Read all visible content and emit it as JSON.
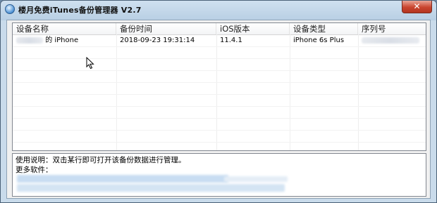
{
  "window": {
    "title": "楼月免费iTunes备份管理器 V2.7",
    "close_glyph": "✕"
  },
  "backup_list": {
    "columns": [
      {
        "label": "设备名称"
      },
      {
        "label": "备份时间"
      },
      {
        "label": "iOS版本"
      },
      {
        "label": "设备类型"
      },
      {
        "label": "序列号"
      }
    ],
    "rows": [
      {
        "device_name": "的 iPhone",
        "backup_time": "2018-09-23 19:31:14",
        "ios_version": "11.4.1",
        "device_type": "iPhone 6s Plus",
        "serial": ""
      }
    ]
  },
  "info_panel": {
    "usage_text": "使用说明：双击某行即可打开该备份数据进行管理。",
    "more_software_label": "更多软件："
  },
  "icons": {
    "app": "app-icon",
    "cursor": "mouse-cursor-icon"
  }
}
